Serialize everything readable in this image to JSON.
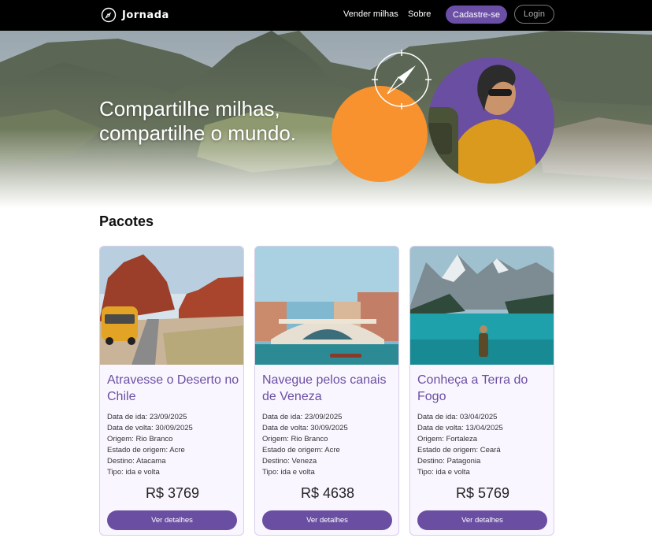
{
  "header": {
    "brand": "Jornada",
    "nav": [
      {
        "label": "Vender milhas"
      },
      {
        "label": "Sobre"
      }
    ],
    "signup_label": "Cadastre-se",
    "login_label": "Login"
  },
  "hero": {
    "title_line1": "Compartilhe milhas,",
    "title_line2": "compartilhe o mundo."
  },
  "section": {
    "title": "Pacotes"
  },
  "labels": {
    "departure": "Data de ida:",
    "return": "Data de volta:",
    "origin": "Origem:",
    "origin_state": "Estado de origem:",
    "destination": "Destino:",
    "type": "Tipo:"
  },
  "packages": [
    {
      "title": "Atravesse o Deserto no Chile",
      "departure": "23/09/2025",
      "return": "30/09/2025",
      "origin": "Rio Branco",
      "origin_state": "Acre",
      "destination": "Atacama",
      "type": "ida e volta",
      "price": "R$ 3769",
      "button": "Ver detalhes"
    },
    {
      "title": "Navegue pelos canais de Veneza",
      "departure": "23/09/2025",
      "return": "30/09/2025",
      "origin": "Rio Branco",
      "origin_state": "Acre",
      "destination": "Veneza",
      "type": "ida e volta",
      "price": "R$ 4638",
      "button": "Ver detalhes"
    },
    {
      "title": "Conheça a Terra do Fogo",
      "departure": "03/04/2025",
      "return": "13/04/2025",
      "origin": "Fortaleza",
      "origin_state": "Ceará",
      "destination": "Patagonia",
      "type": "ida e volta",
      "price": "R$ 5769",
      "button": "Ver detalhes"
    }
  ],
  "colors": {
    "accent": "#6b4fa6",
    "orange": "#f7922e",
    "header_bg": "#000000",
    "card_bg": "#faf6ff"
  },
  "icons": [
    "compass-icon",
    "logo-compass-icon"
  ]
}
